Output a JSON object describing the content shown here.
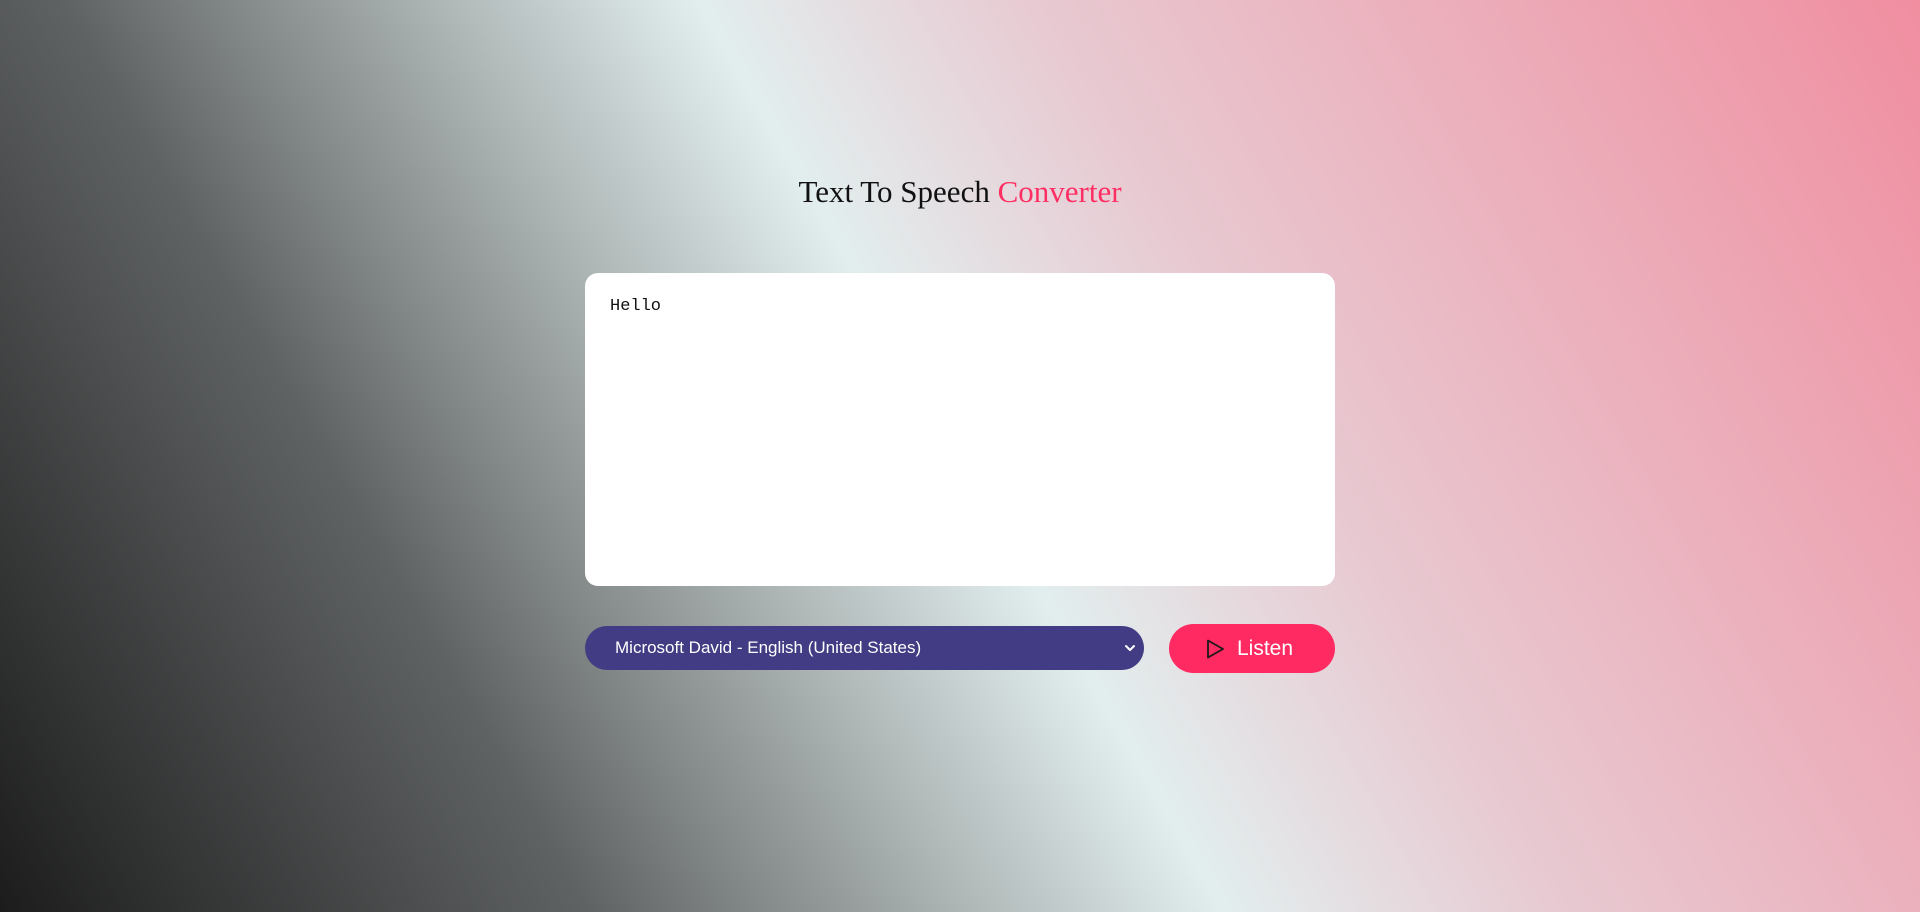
{
  "title": {
    "main": "Text To Speech",
    "accent": "Converter"
  },
  "textarea": {
    "value": "Hello"
  },
  "voice_select": {
    "selected": "Microsoft David - English (United States)"
  },
  "listen_button": {
    "label": "Listen"
  },
  "icons": {
    "play": "play-icon",
    "chevron": "chevron-down-icon"
  },
  "colors": {
    "accent": "#ff2e63",
    "select_bg": "#413c83",
    "button_bg": "#ff2a62"
  }
}
